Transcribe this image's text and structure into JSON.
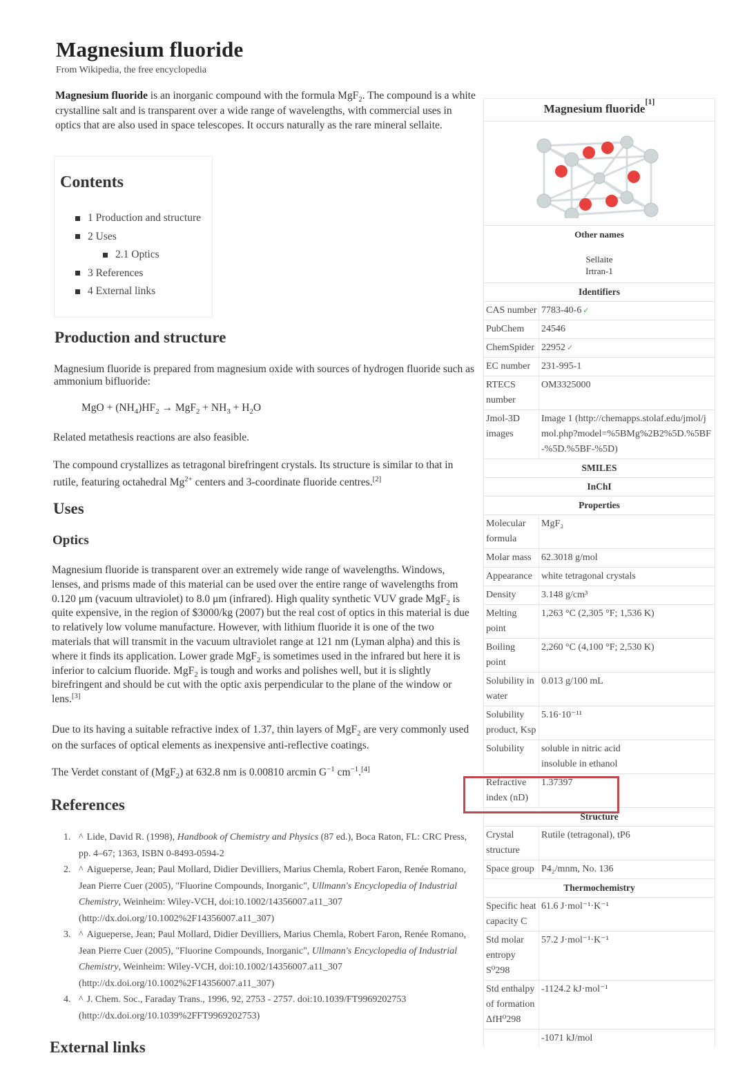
{
  "page": {
    "title": "Magnesium fluoride",
    "tagline": "From Wikipedia, the free encyclopedia",
    "lead": {
      "bold": "Magnesium fluoride",
      "text_1": " is an inorganic compound with the formula MgF",
      "sub_1": "2",
      "text_2": ". The compound is a white crystalline salt and is transparent over a wide range of wavelengths, with commercial uses in optics that are also used in space telescopes. It occurs naturally as the rare mineral sellaite."
    }
  },
  "toc": {
    "title": "Contents",
    "items": [
      {
        "label": "1 Production and structure",
        "level": 1
      },
      {
        "label": "2 Uses",
        "level": 1
      },
      {
        "label": "2.1 Optics",
        "level": 2
      },
      {
        "label": "3 References",
        "level": 1
      },
      {
        "label": "4 External links",
        "level": 1
      }
    ]
  },
  "production": {
    "heading": "Production and structure",
    "para1": "Magnesium fluoride is prepared from magnesium oxide with sources of hydrogen fluoride such as ammonium bifluoride:",
    "equation": {
      "p1": "MgO + (NH",
      "s1": "4",
      "p2": ")HF",
      "s2": "2",
      "p3": " → MgF",
      "s3": "2",
      "p4": " + NH",
      "s4": "3",
      "p5": " + H",
      "s5": "2",
      "p6": "O"
    },
    "para2": "Related metathesis reactions are also feasible.",
    "para3_a": "The compound crystallizes as tetragonal birefringent crystals. Its structure is similar to that in rutile, featuring octahedral Mg",
    "para3_sup": "2+",
    "para3_b": " centers and 3-coordinate fluoride centres.",
    "para3_ref": "[2]"
  },
  "uses": {
    "heading": "Uses",
    "optics_heading": "Optics",
    "p1_a": "Magnesium fluoride is transparent over an extremely wide range of wavelengths. Windows, lenses, and prisms made of this material can be used over the entire range of wavelengths from 0.120 μm (vacuum ultraviolet) to 8.0 μm (infrared). High quality synthetic VUV grade MgF",
    "p1_s1": "2",
    "p1_b": " is quite expensive, in the region of $3000/kg (2007) but the real cost of optics in this material is due to relatively low volume manufacture. However, with lithium fluoride it is one of the two materials that will transmit in the vacuum ultraviolet range at 121 nm (Lyman alpha) and this is where it finds its application. Lower grade MgF",
    "p1_s2": "2",
    "p1_c": " is sometimes used in the infrared but here it is inferior to calcium fluoride. MgF",
    "p1_s3": "2",
    "p1_d": " is tough and works and polishes well, but it is slightly birefringent and should be cut with the optic axis perpendicular to the plane of the window or lens.",
    "p1_ref": "[3]",
    "p2_a": "Due to its having a suitable refractive index of 1.37, thin layers of MgF",
    "p2_s": "2",
    "p2_b": " are very commonly used on the surfaces of optical elements as inexpensive anti-reflective coatings.",
    "p3_a": "The Verdet constant of (MgF",
    "p3_s": "2",
    "p3_b": ") at 632.8 nm is 0.00810 arcmin G",
    "p3_sup1": "−1",
    "p3_c": " cm",
    "p3_sup2": "−1",
    "p3_d": ".",
    "p3_ref": "[4]"
  },
  "references": {
    "heading": "References",
    "items": [
      {
        "num": "1.",
        "pre": "Lide, David R. (1998), ",
        "ital": "Handbook of Chemistry and Physics",
        "post": " (87 ed.), Boca Raton, FL: CRC Press, pp. 4–67; 1363, ISBN 0-8493-0594-2"
      },
      {
        "num": "2.",
        "pre": "Aigueperse, Jean; Paul Mollard, Didier Devilliers, Marius Chemla, Robert Faron, Renée Romano, Jean Pierre Cuer (2005), \"Fluorine Compounds, Inorganic\", ",
        "ital": "Ullmann's Encyclopedia of Industrial Chemistry",
        "post": ", Weinheim: Wiley-VCH, doi:10.1002/14356007.a11_307 (http://dx.doi.org/10.1002%2F14356007.a11_307)"
      },
      {
        "num": "3.",
        "pre": "Aigueperse, Jean; Paul Mollard, Didier Devilliers, Marius Chemla, Robert Faron, Renée Romano, Jean Pierre Cuer (2005), \"Fluorine Compounds, Inorganic\", ",
        "ital": "Ullmann's Encyclopedia of Industrial Chemistry",
        "post": ", Weinheim: Wiley-VCH, doi:10.1002/14356007.a11_307 (http://dx.doi.org/10.1002%2F14356007.a11_307)"
      },
      {
        "num": "4.",
        "pre": "J. Chem. Soc., Faraday Trans., 1996, 92, 2753 - 2757. doi:10.1039/FT9969202753 (http://dx.doi.org/10.1039%2FFT9969202753)",
        "ital": "",
        "post": ""
      }
    ],
    "caret": "^"
  },
  "external_links": {
    "heading": "External links"
  },
  "infobox": {
    "title": "Magnesium fluoride",
    "title_ref": "[1]",
    "image_icon": "crystal-structure-image",
    "colors": {
      "cation": "#cfd6d8",
      "anion": "#e8403c",
      "highlight": "#c0474e",
      "check": "#4aa84a"
    },
    "other_names_heading": "Other names",
    "other_names": [
      "Sellaite",
      "Irtran-1"
    ],
    "identifiers_heading": "Identifiers",
    "identifiers": [
      {
        "label": "CAS number",
        "value": "7783-40-6",
        "check": true
      },
      {
        "label": "PubChem",
        "value": "24546",
        "check": false
      },
      {
        "label": "ChemSpider",
        "value": "22952",
        "check": true
      },
      {
        "label": "EC number",
        "value": "231-995-1",
        "check": false
      },
      {
        "label": "RTECS number",
        "value": "OM3325000",
        "check": false
      },
      {
        "label": "Jmol-3D images",
        "value": "Image 1 (http://chemapps.stolaf.edu/jmol/jmol.php?model=%5BMg%2B2%5D.%5BF-%5D.%5BF-%5D)",
        "check": false
      }
    ],
    "smiles": "SMILES",
    "inchi": "InChI",
    "properties_heading": "Properties",
    "properties": [
      {
        "label": "Molecular formula",
        "value": "MgF₂"
      },
      {
        "label": "Molar mass",
        "value": "62.3018 g/mol"
      },
      {
        "label": "Appearance",
        "value": "white tetragonal crystals"
      },
      {
        "label": "Density",
        "value": "3.148 g/cm³"
      },
      {
        "label": "Melting point",
        "value": "1,263 °C (2,305 °F; 1,536 K)"
      },
      {
        "label": "Boiling point",
        "value": "2,260 °C (4,100 °F; 2,530 K)"
      },
      {
        "label": "Solubility in water",
        "value": "0.013 g/100 mL"
      },
      {
        "label": "Solubility product, Ksp",
        "value": "5.16·10⁻¹¹"
      },
      {
        "label": "Solubility",
        "value": "soluble in nitric acid\ninsoluble in ethanol"
      },
      {
        "label": "Refractive index (nD)",
        "value": "1.37397"
      }
    ],
    "structure_heading": "Structure",
    "structure": [
      {
        "label": "Crystal structure",
        "value": "Rutile (tetragonal), tP6"
      },
      {
        "label": "Space group",
        "value": "P4₂/mnm, No. 136"
      }
    ],
    "thermo_heading": "Thermochemistry",
    "thermo": [
      {
        "label": "Specific heat capacity C",
        "value": "61.6 J·mol⁻¹·K⁻¹"
      },
      {
        "label": "Std molar entropy S⁰298",
        "value": "57.2 J·mol⁻¹·K⁻¹"
      },
      {
        "label": "Std enthalpy of formation ΔfH⁰298",
        "value": "-1124.2 kJ·mol⁻¹"
      },
      {
        "label": "",
        "value": "-1071 kJ/mol"
      }
    ]
  }
}
